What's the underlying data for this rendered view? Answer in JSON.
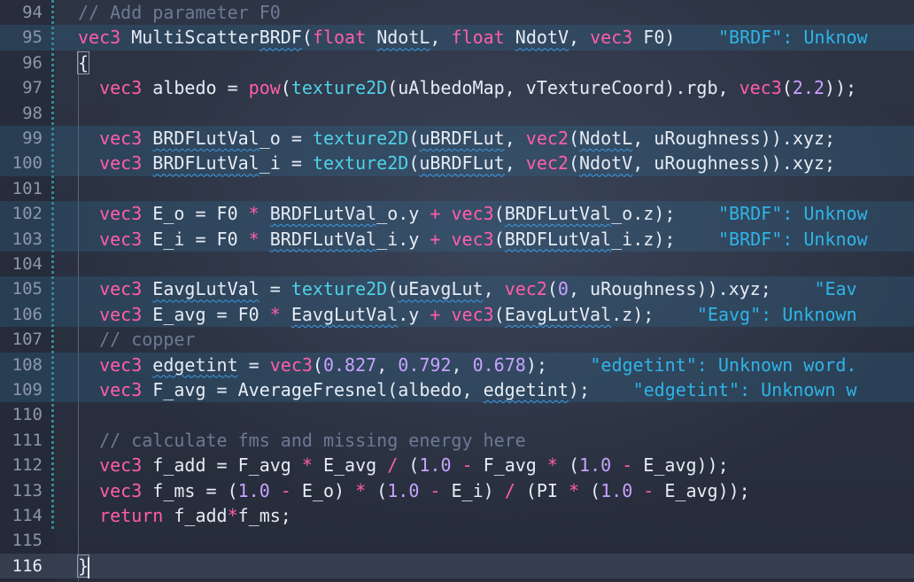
{
  "editor": {
    "lines": [
      {
        "number": "94",
        "tokens": [
          {
            "t": "// Add parameter F0",
            "c": "c"
          }
        ]
      },
      {
        "number": "95",
        "highlight": true,
        "tokens": [
          {
            "t": "vec3",
            "c": "k"
          },
          {
            "t": " MultiScatter",
            "c": "d"
          },
          {
            "t": "BRDF",
            "c": "d",
            "u": true
          },
          {
            "t": "(",
            "c": "d"
          },
          {
            "t": "float",
            "c": "k"
          },
          {
            "t": " ",
            "c": "d"
          },
          {
            "t": "NdotL",
            "c": "d",
            "u": true
          },
          {
            "t": ", ",
            "c": "d"
          },
          {
            "t": "float",
            "c": "k"
          },
          {
            "t": " ",
            "c": "d"
          },
          {
            "t": "NdotV",
            "c": "d",
            "u": true
          },
          {
            "t": ", ",
            "c": "d"
          },
          {
            "t": "vec3",
            "c": "k"
          },
          {
            "t": " F0)",
            "c": "d"
          }
        ],
        "hint": "\"BRDF\": Unknow"
      },
      {
        "number": "96",
        "tokens": [
          {
            "t": "{",
            "c": "d",
            "bracket": true
          }
        ]
      },
      {
        "number": "97",
        "tokens": [
          {
            "t": "  vec3",
            "c": "k"
          },
          {
            "t": " albedo = ",
            "c": "d"
          },
          {
            "t": "pow",
            "c": "k"
          },
          {
            "t": "(",
            "c": "d"
          },
          {
            "t": "texture2D",
            "c": "f"
          },
          {
            "t": "(uAlbedoMap, vTextureCoord).rgb, ",
            "c": "d"
          },
          {
            "t": "vec3",
            "c": "k"
          },
          {
            "t": "(",
            "c": "d"
          },
          {
            "t": "2.2",
            "c": "n"
          },
          {
            "t": "));",
            "c": "d"
          }
        ]
      },
      {
        "number": "98",
        "tokens": []
      },
      {
        "number": "99",
        "highlight": true,
        "tokens": [
          {
            "t": "  vec3",
            "c": "k"
          },
          {
            "t": " ",
            "c": "d"
          },
          {
            "t": "BRDFLutVal",
            "c": "d",
            "u": true
          },
          {
            "t": "_o = ",
            "c": "d"
          },
          {
            "t": "texture2D",
            "c": "f"
          },
          {
            "t": "(",
            "c": "d"
          },
          {
            "t": "uBRDFLut",
            "c": "d",
            "u": true
          },
          {
            "t": ", ",
            "c": "d"
          },
          {
            "t": "vec2",
            "c": "k"
          },
          {
            "t": "(",
            "c": "d"
          },
          {
            "t": "NdotL",
            "c": "d",
            "u": true
          },
          {
            "t": ", uRoughness)).xyz;",
            "c": "d"
          }
        ]
      },
      {
        "number": "100",
        "highlight": true,
        "tokens": [
          {
            "t": "  vec3",
            "c": "k"
          },
          {
            "t": " ",
            "c": "d"
          },
          {
            "t": "BRDFLutVal",
            "c": "d",
            "u": true
          },
          {
            "t": "_i = ",
            "c": "d"
          },
          {
            "t": "texture2D",
            "c": "f"
          },
          {
            "t": "(",
            "c": "d"
          },
          {
            "t": "uBRDFLut",
            "c": "d",
            "u": true
          },
          {
            "t": ", ",
            "c": "d"
          },
          {
            "t": "vec2",
            "c": "k"
          },
          {
            "t": "(",
            "c": "d"
          },
          {
            "t": "NdotV",
            "c": "d",
            "u": true
          },
          {
            "t": ", uRoughness)).xyz;",
            "c": "d"
          }
        ]
      },
      {
        "number": "101",
        "tokens": []
      },
      {
        "number": "102",
        "highlight": true,
        "tokens": [
          {
            "t": "  vec3",
            "c": "k"
          },
          {
            "t": " E_o = F0 ",
            "c": "d"
          },
          {
            "t": "*",
            "c": "k"
          },
          {
            "t": " ",
            "c": "d"
          },
          {
            "t": "BRDFLutVal",
            "c": "d",
            "u": true
          },
          {
            "t": "_o.y ",
            "c": "d"
          },
          {
            "t": "+",
            "c": "k"
          },
          {
            "t": " ",
            "c": "d"
          },
          {
            "t": "vec3",
            "c": "k"
          },
          {
            "t": "(",
            "c": "d"
          },
          {
            "t": "BRDFLutVal",
            "c": "d",
            "u": true
          },
          {
            "t": "_o.z);",
            "c": "d"
          }
        ],
        "hint": "\"BRDF\": Unknow"
      },
      {
        "number": "103",
        "highlight": true,
        "tokens": [
          {
            "t": "  vec3",
            "c": "k"
          },
          {
            "t": " E_i = F0 ",
            "c": "d"
          },
          {
            "t": "*",
            "c": "k"
          },
          {
            "t": " ",
            "c": "d"
          },
          {
            "t": "BRDFLutVal",
            "c": "d",
            "u": true
          },
          {
            "t": "_i.y ",
            "c": "d"
          },
          {
            "t": "+",
            "c": "k"
          },
          {
            "t": " ",
            "c": "d"
          },
          {
            "t": "vec3",
            "c": "k"
          },
          {
            "t": "(",
            "c": "d"
          },
          {
            "t": "BRDFLutVal",
            "c": "d",
            "u": true
          },
          {
            "t": "_i.z);",
            "c": "d"
          }
        ],
        "hint": "\"BRDF\": Unknow"
      },
      {
        "number": "104",
        "tokens": []
      },
      {
        "number": "105",
        "highlight": true,
        "tokens": [
          {
            "t": "  vec3",
            "c": "k"
          },
          {
            "t": " ",
            "c": "d"
          },
          {
            "t": "EavgLutVal",
            "c": "d",
            "u": true
          },
          {
            "t": " = ",
            "c": "d"
          },
          {
            "t": "texture2D",
            "c": "f"
          },
          {
            "t": "(",
            "c": "d"
          },
          {
            "t": "uEavgLut",
            "c": "d",
            "u": true
          },
          {
            "t": ", ",
            "c": "d"
          },
          {
            "t": "vec2",
            "c": "k"
          },
          {
            "t": "(",
            "c": "d"
          },
          {
            "t": "0",
            "c": "n"
          },
          {
            "t": ", uRoughness)).xyz;",
            "c": "d"
          }
        ],
        "hint": "\"Eav"
      },
      {
        "number": "106",
        "highlight": true,
        "tokens": [
          {
            "t": "  vec3",
            "c": "k"
          },
          {
            "t": " E_avg = F0 ",
            "c": "d"
          },
          {
            "t": "*",
            "c": "k"
          },
          {
            "t": " ",
            "c": "d"
          },
          {
            "t": "EavgLutVal",
            "c": "d",
            "u": true
          },
          {
            "t": ".y ",
            "c": "d"
          },
          {
            "t": "+",
            "c": "k"
          },
          {
            "t": " ",
            "c": "d"
          },
          {
            "t": "vec3",
            "c": "k"
          },
          {
            "t": "(",
            "c": "d"
          },
          {
            "t": "EavgLutVal",
            "c": "d",
            "u": true
          },
          {
            "t": ".z);",
            "c": "d"
          }
        ],
        "hint": "\"Eavg\": Unknown"
      },
      {
        "number": "107",
        "tokens": [
          {
            "t": "  // copper",
            "c": "c"
          }
        ]
      },
      {
        "number": "108",
        "highlight": true,
        "tokens": [
          {
            "t": "  vec3",
            "c": "k"
          },
          {
            "t": " ",
            "c": "d"
          },
          {
            "t": "edgetint",
            "c": "d",
            "u": true
          },
          {
            "t": " = ",
            "c": "d"
          },
          {
            "t": "vec3",
            "c": "k"
          },
          {
            "t": "(",
            "c": "d"
          },
          {
            "t": "0.827",
            "c": "n"
          },
          {
            "t": ", ",
            "c": "d"
          },
          {
            "t": "0.792",
            "c": "n"
          },
          {
            "t": ", ",
            "c": "d"
          },
          {
            "t": "0.678",
            "c": "n"
          },
          {
            "t": ");",
            "c": "d"
          }
        ],
        "hint": "\"edgetint\": Unknown word."
      },
      {
        "number": "109",
        "highlight": true,
        "tokens": [
          {
            "t": "  vec3",
            "c": "k"
          },
          {
            "t": " F_avg = AverageFresnel(albedo, ",
            "c": "d"
          },
          {
            "t": "edgetint",
            "c": "d",
            "u": true
          },
          {
            "t": ");",
            "c": "d"
          }
        ],
        "hint": "\"edgetint\": Unknown w"
      },
      {
        "number": "110",
        "tokens": []
      },
      {
        "number": "111",
        "tokens": [
          {
            "t": "  // calculate fms and missing energy here",
            "c": "c"
          }
        ]
      },
      {
        "number": "112",
        "tokens": [
          {
            "t": "  vec3",
            "c": "k"
          },
          {
            "t": " f_add = F_avg ",
            "c": "d"
          },
          {
            "t": "*",
            "c": "k"
          },
          {
            "t": " E_avg ",
            "c": "d"
          },
          {
            "t": "/",
            "c": "k"
          },
          {
            "t": " (",
            "c": "d"
          },
          {
            "t": "1.0",
            "c": "n"
          },
          {
            "t": " ",
            "c": "d"
          },
          {
            "t": "-",
            "c": "k"
          },
          {
            "t": " F_avg ",
            "c": "d"
          },
          {
            "t": "*",
            "c": "k"
          },
          {
            "t": " (",
            "c": "d"
          },
          {
            "t": "1.0",
            "c": "n"
          },
          {
            "t": " ",
            "c": "d"
          },
          {
            "t": "-",
            "c": "k"
          },
          {
            "t": " E_avg));",
            "c": "d"
          }
        ]
      },
      {
        "number": "113",
        "tokens": [
          {
            "t": "  vec3",
            "c": "k"
          },
          {
            "t": " f_ms = (",
            "c": "d"
          },
          {
            "t": "1.0",
            "c": "n"
          },
          {
            "t": " ",
            "c": "d"
          },
          {
            "t": "-",
            "c": "k"
          },
          {
            "t": " E_o) ",
            "c": "d"
          },
          {
            "t": "*",
            "c": "k"
          },
          {
            "t": " (",
            "c": "d"
          },
          {
            "t": "1.0",
            "c": "n"
          },
          {
            "t": " ",
            "c": "d"
          },
          {
            "t": "-",
            "c": "k"
          },
          {
            "t": " E_i) ",
            "c": "d"
          },
          {
            "t": "/",
            "c": "k"
          },
          {
            "t": " (PI ",
            "c": "d"
          },
          {
            "t": "*",
            "c": "k"
          },
          {
            "t": " (",
            "c": "d"
          },
          {
            "t": "1.0",
            "c": "n"
          },
          {
            "t": " ",
            "c": "d"
          },
          {
            "t": "-",
            "c": "k"
          },
          {
            "t": " E_avg));",
            "c": "d"
          }
        ]
      },
      {
        "number": "114",
        "tokens": [
          {
            "t": "  return",
            "c": "k"
          },
          {
            "t": " f_add",
            "c": "d"
          },
          {
            "t": "*",
            "c": "k"
          },
          {
            "t": "f_ms;",
            "c": "d"
          }
        ]
      },
      {
        "number": "115",
        "tokens": []
      },
      {
        "number": "116",
        "current": true,
        "tokens": [
          {
            "t": "}",
            "c": "d",
            "bracket": true
          }
        ]
      }
    ]
  }
}
